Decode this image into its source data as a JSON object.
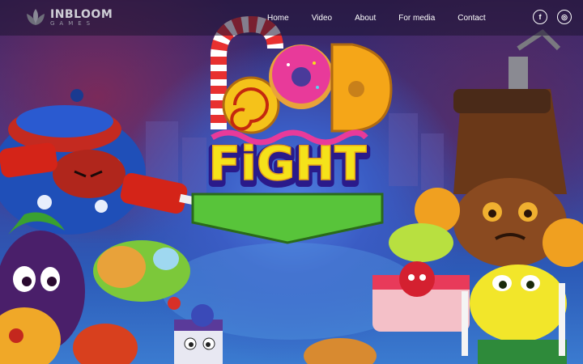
{
  "brand": {
    "name": "INBLOOM",
    "tagline": "GAMES"
  },
  "nav": {
    "items": [
      {
        "label": "Home"
      },
      {
        "label": "Video"
      },
      {
        "label": "About"
      },
      {
        "label": "For media"
      },
      {
        "label": "Contact"
      }
    ]
  },
  "socials": {
    "facebook_glyph": "f",
    "instagram_glyph": "◎"
  },
  "hero": {
    "logo_top": "FOOD",
    "logo_bottom": "FiGHT"
  },
  "colors": {
    "header_bg": "#1e1432",
    "logo_yellow": "#f5d21a",
    "logo_green": "#58c43a",
    "donut_pink": "#e83a9a"
  }
}
